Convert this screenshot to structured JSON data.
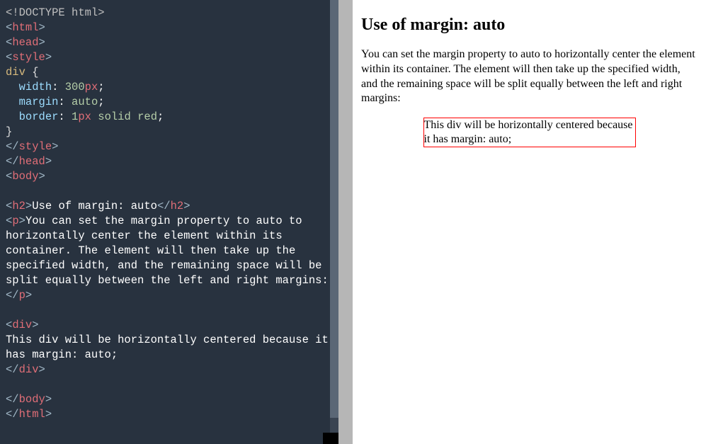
{
  "code": {
    "doctype": "<!DOCTYPE html>",
    "tag_html": "html",
    "tag_head": "head",
    "tag_style": "style",
    "tag_body": "body",
    "tag_h2": "h2",
    "tag_p": "p",
    "tag_div": "div",
    "selector": "div",
    "decl_width_prop": "width",
    "decl_width_val": "300",
    "decl_width_unit": "px",
    "decl_margin_prop": "margin",
    "decl_margin_val": "auto",
    "decl_border_prop": "border",
    "decl_border_num": "1",
    "decl_border_unit": "px",
    "decl_border_rest": "solid red",
    "h2_text": "Use of margin: auto",
    "p_text": "You can set the margin property to auto to horizontally center the element within its container. The element will then take up the specified width, and the remaining space will be split equally between the left and right margins:",
    "div_text": "This div will be horizontally centered because it has margin: auto;"
  },
  "preview": {
    "heading": "Use of margin: auto",
    "paragraph": "You can set the margin property to auto to horizontally center the element within its container. The element will then take up the specified width, and the remaining space will be split equally between the left and right margins:",
    "box_text": "This div will be horizontally centered because it has margin: auto;"
  }
}
